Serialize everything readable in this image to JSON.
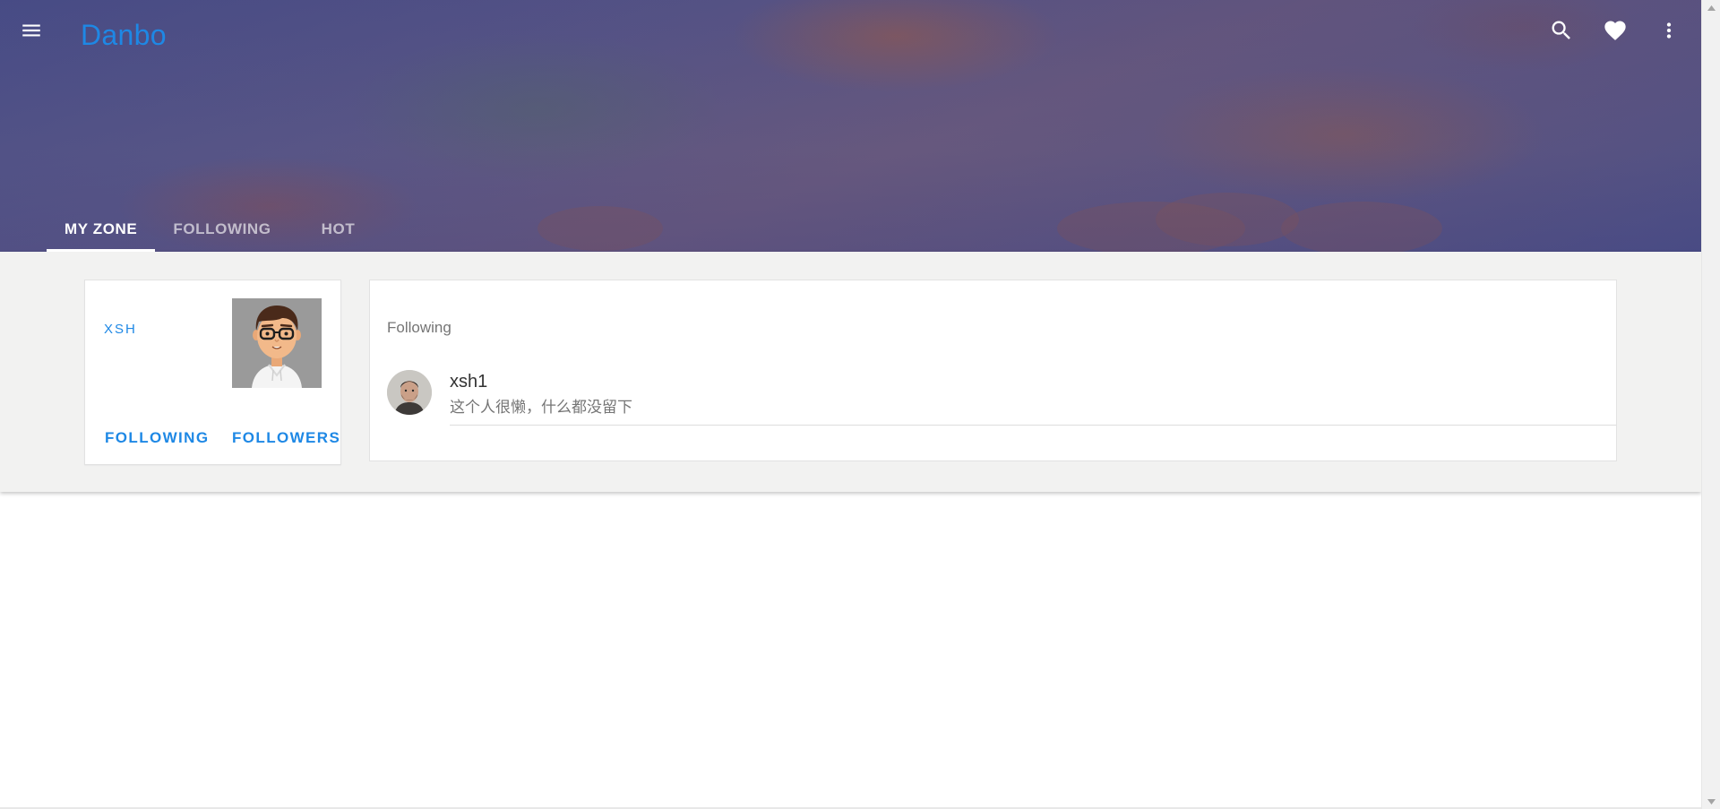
{
  "app": {
    "brand": "Danbo",
    "accent_color": "#1e88e5"
  },
  "toolbar": {
    "menu_icon": "menu-icon",
    "search_icon": "search-icon",
    "favorites_icon": "heart-icon",
    "more_icon": "more-vert-icon"
  },
  "tabs": [
    {
      "label": "MY ZONE",
      "active": true
    },
    {
      "label": "FOLLOWING",
      "active": false
    },
    {
      "label": "HOT",
      "active": false
    }
  ],
  "profile": {
    "name": "XSH",
    "following_label": "FOLLOWING",
    "followers_label": "FOLLOWERS"
  },
  "following_panel": {
    "title": "Following",
    "users": [
      {
        "name": "xsh1",
        "bio": "这个人很懒，什么都没留下"
      }
    ]
  }
}
